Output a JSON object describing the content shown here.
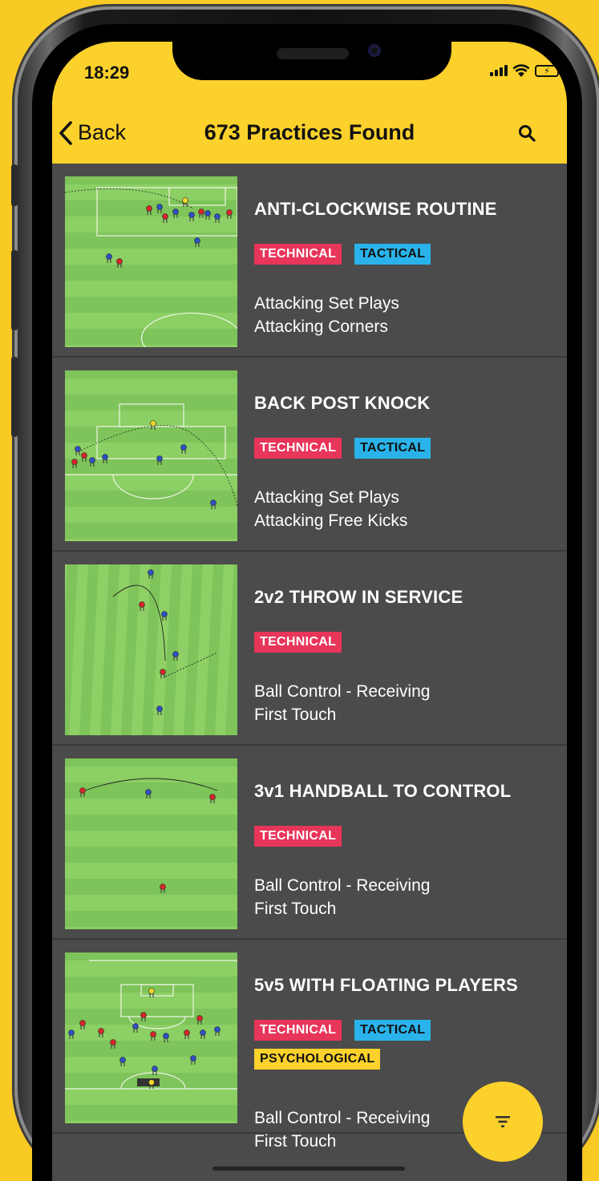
{
  "status_bar": {
    "time": "18:29",
    "battery_glyph": "⚡"
  },
  "nav": {
    "back_label": "Back",
    "title": "673 Practices Found"
  },
  "colors": {
    "accent": "#fdd12b",
    "technical": "#e8355a",
    "tactical": "#2ab3ea",
    "list_bg": "#4b4b4b"
  },
  "practices": [
    {
      "title": "ANTI-CLOCKWISE ROUTINE",
      "tags": [
        "TECHNICAL",
        "TACTICAL"
      ],
      "categories": [
        "Attacking Set Plays",
        "Attacking Corners"
      ],
      "diagram": "corner"
    },
    {
      "title": "BACK POST KNOCK",
      "tags": [
        "TECHNICAL",
        "TACTICAL"
      ],
      "categories": [
        "Attacking Set Plays",
        "Attacking Free Kicks"
      ],
      "diagram": "freekick"
    },
    {
      "title": "2v2 THROW IN SERVICE",
      "tags": [
        "TECHNICAL"
      ],
      "categories": [
        "Ball Control - Receiving",
        "First Touch"
      ],
      "diagram": "stripes"
    },
    {
      "title": "3v1 HANDBALL TO CONTROL",
      "tags": [
        "TECHNICAL"
      ],
      "categories": [
        "Ball Control - Receiving",
        "First Touch"
      ],
      "diagram": "bands"
    },
    {
      "title": "5v5 WITH FLOATING PLAYERS",
      "tags": [
        "TECHNICAL",
        "TACTICAL",
        "PSYCHOLOGICAL"
      ],
      "categories": [
        "Ball Control - Receiving",
        "First Touch"
      ],
      "diagram": "smallsided"
    }
  ],
  "icons": {
    "back": "chevron-left-icon",
    "search": "search-icon",
    "filter": "filter-icon"
  }
}
